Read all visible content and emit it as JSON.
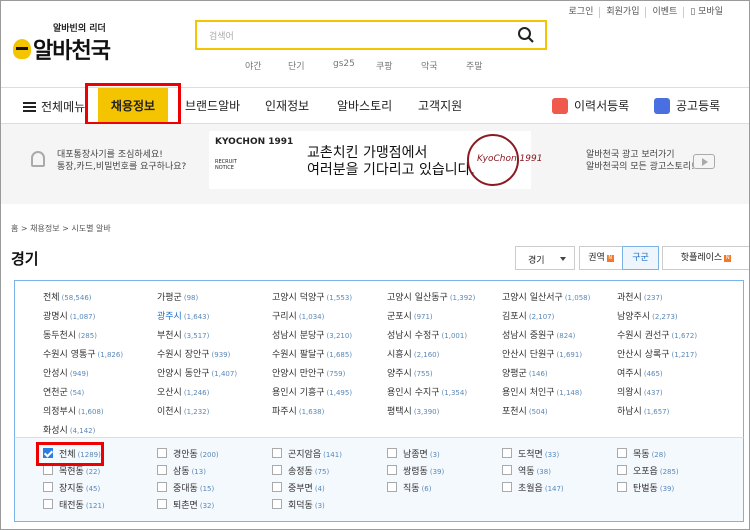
{
  "util_links": [
    "로그인",
    "회원가입",
    "이벤트",
    "모바일"
  ],
  "logo": {
    "tagline": "알바빈의 리더",
    "name": "알바천국"
  },
  "search": {
    "placeholder": "검색어"
  },
  "keywords": [
    "야간",
    "단기",
    "gs25",
    "쿠팡",
    "악국",
    "주말"
  ],
  "nav": {
    "all_menu": "전체메뉴",
    "tabs": [
      "채용정보",
      "브랜드알바",
      "인재정보",
      "알바스토리",
      "고객지원"
    ],
    "active_tab": "채용정보",
    "resume": "이력서등록",
    "ad_register": "공고등록"
  },
  "banner": {
    "left_line1": "대포통장사기를 조심하세요!",
    "left_line2": "통장,카드,비밀번호를 요구하나요?",
    "ad_brand": "KYOCHON 1991",
    "ad_recruit": "RECRUIT",
    "ad_notice": "NOTICE",
    "ad_line1": "교촌치킨 가맹점에서",
    "ad_line2": "여러분을 기다리고 있습니다.",
    "ad_seal": "KyoChon 1991",
    "right_line1": "알바천국 광고 보러가기",
    "right_line2": "알바천국의 모든 광고스토리!"
  },
  "breadcrumb": "홈 > 채용정보 > 시도별 알바",
  "region_title": "경기",
  "region_select": "경기",
  "view_tabs": [
    {
      "label": "권역",
      "badge": "N"
    },
    {
      "label": "구군",
      "badge": ""
    },
    {
      "label": "핫플레이스",
      "badge": "N"
    }
  ],
  "active_view": "구군",
  "districts": [
    {
      "name": "전체",
      "count": "(58,546)"
    },
    {
      "name": "가평군",
      "count": "(98)"
    },
    {
      "name": "고양시 덕양구",
      "count": "(1,553)"
    },
    {
      "name": "고양시 일산동구",
      "count": "(1,392)"
    },
    {
      "name": "고양시 일산서구",
      "count": "(1,058)"
    },
    {
      "name": "과천시",
      "count": "(237)"
    },
    {
      "name": "광명시",
      "count": "(1,087)"
    },
    {
      "name": "광주시",
      "count": "(1,643)"
    },
    {
      "name": "구리시",
      "count": "(1,034)"
    },
    {
      "name": "군포시",
      "count": "(971)"
    },
    {
      "name": "김포시",
      "count": "(2,107)"
    },
    {
      "name": "남양주시",
      "count": "(2,273)"
    },
    {
      "name": "동두천시",
      "count": "(285)"
    },
    {
      "name": "부천시",
      "count": "(3,517)"
    },
    {
      "name": "성남시 분당구",
      "count": "(3,210)"
    },
    {
      "name": "성남시 수정구",
      "count": "(1,001)"
    },
    {
      "name": "성남시 중원구",
      "count": "(824)"
    },
    {
      "name": "수원시 권선구",
      "count": "(1,672)"
    },
    {
      "name": "수원시 영통구",
      "count": "(1,826)"
    },
    {
      "name": "수원시 장안구",
      "count": "(939)"
    },
    {
      "name": "수원시 팔달구",
      "count": "(1,685)"
    },
    {
      "name": "시흥시",
      "count": "(2,160)"
    },
    {
      "name": "안산시 단원구",
      "count": "(1,691)"
    },
    {
      "name": "안산시 상록구",
      "count": "(1,217)"
    },
    {
      "name": "안성시",
      "count": "(949)"
    },
    {
      "name": "안양시 동안구",
      "count": "(1,407)"
    },
    {
      "name": "안양시 만안구",
      "count": "(759)"
    },
    {
      "name": "양주시",
      "count": "(755)"
    },
    {
      "name": "양평군",
      "count": "(146)"
    },
    {
      "name": "여주시",
      "count": "(465)"
    },
    {
      "name": "연천군",
      "count": "(54)"
    },
    {
      "name": "오산시",
      "count": "(1,246)"
    },
    {
      "name": "용인시 기흥구",
      "count": "(1,495)"
    },
    {
      "name": "용인시 수지구",
      "count": "(1,354)"
    },
    {
      "name": "용인시 처인구",
      "count": "(1,148)"
    },
    {
      "name": "의왕시",
      "count": "(437)"
    },
    {
      "name": "의정부시",
      "count": "(1,608)"
    },
    {
      "name": "이천시",
      "count": "(1,232)"
    },
    {
      "name": "파주시",
      "count": "(1,638)"
    },
    {
      "name": "평택시",
      "count": "(3,390)"
    },
    {
      "name": "포천시",
      "count": "(504)"
    },
    {
      "name": "하남시",
      "count": "(1,657)"
    },
    {
      "name": "화성시",
      "count": "(4,142)"
    }
  ],
  "active_district": "광주시",
  "dongs": [
    {
      "name": "전체",
      "count": "(1289)",
      "checked": true
    },
    {
      "name": "경안동",
      "count": "(200)"
    },
    {
      "name": "곤지암읍",
      "count": "(141)"
    },
    {
      "name": "남종면",
      "count": "(3)"
    },
    {
      "name": "도척면",
      "count": "(33)"
    },
    {
      "name": "목동",
      "count": "(28)"
    },
    {
      "name": "목현동",
      "count": "(22)"
    },
    {
      "name": "삼동",
      "count": "(13)"
    },
    {
      "name": "송정동",
      "count": "(75)"
    },
    {
      "name": "쌍령동",
      "count": "(39)"
    },
    {
      "name": "역동",
      "count": "(38)"
    },
    {
      "name": "오포읍",
      "count": "(285)"
    },
    {
      "name": "장지동",
      "count": "(45)"
    },
    {
      "name": "중대동",
      "count": "(15)"
    },
    {
      "name": "중부면",
      "count": "(4)"
    },
    {
      "name": "직동",
      "count": "(6)"
    },
    {
      "name": "초월읍",
      "count": "(147)"
    },
    {
      "name": "탄벌동",
      "count": "(39)"
    },
    {
      "name": "태전동",
      "count": "(121)"
    },
    {
      "name": "퇴촌면",
      "count": "(32)"
    },
    {
      "name": "회덕동",
      "count": "(3)"
    }
  ],
  "colors": {
    "accent": "#f5c400",
    "highlight_box": "#ee0000",
    "link_blue": "#1a6fcf"
  }
}
